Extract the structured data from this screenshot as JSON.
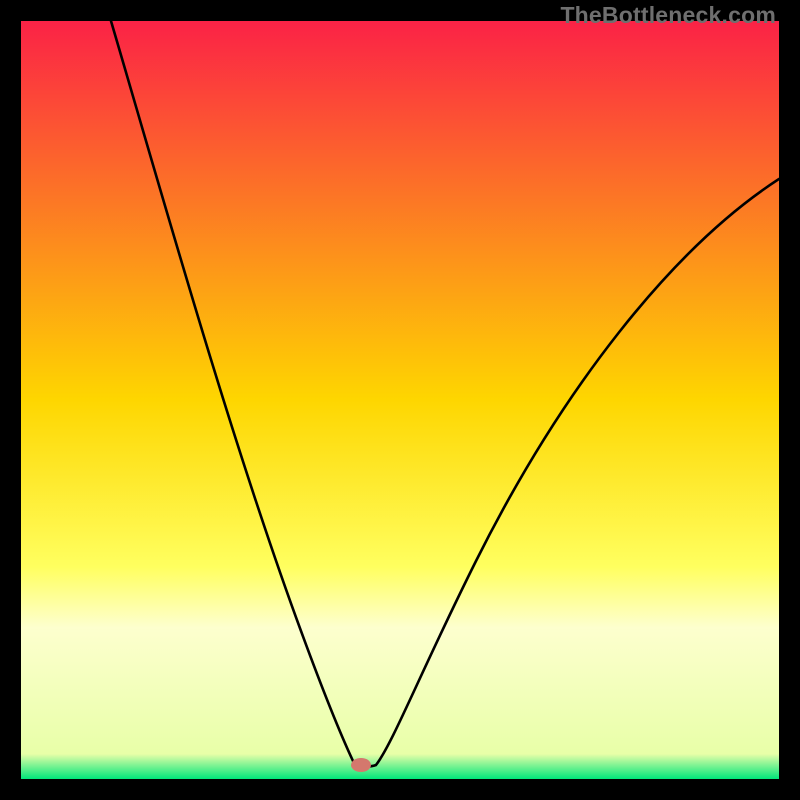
{
  "watermark": "TheBottleneck.com",
  "chart_data": {
    "type": "line",
    "title": "",
    "xlabel": "",
    "ylabel": "",
    "xlim": [
      0,
      100
    ],
    "ylim": [
      0,
      100
    ],
    "grid": false,
    "legend": false,
    "marker": {
      "x": 44.5,
      "y": 1.7,
      "color": "#d4786d"
    },
    "green_band": {
      "y_start": 0,
      "y_end": 3.3
    },
    "gradient_stops": [
      {
        "pos": 0.0,
        "color": "#fb2246"
      },
      {
        "pos": 0.5,
        "color": "#fed600"
      },
      {
        "pos": 0.72,
        "color": "#ffff5f"
      },
      {
        "pos": 0.8,
        "color": "#fdffce"
      },
      {
        "pos": 0.97,
        "color": "#e8ffa8"
      },
      {
        "pos": 1.0,
        "color": "#00e67a"
      }
    ],
    "series": [
      {
        "name": "bottleneck-curve",
        "x": [
          12,
          15,
          18,
          21,
          24,
          27,
          30,
          33,
          36,
          38,
          40,
          42,
          43,
          44,
          45,
          46,
          47,
          50,
          55,
          60,
          65,
          70,
          75,
          80,
          85,
          90,
          95,
          100
        ],
        "y": [
          100,
          89,
          79,
          69,
          59,
          50,
          41,
          33,
          25,
          19,
          13,
          8,
          5,
          2,
          1,
          2,
          4,
          9,
          17,
          24,
          31,
          38,
          44,
          50,
          55,
          60,
          65,
          70
        ]
      }
    ]
  }
}
